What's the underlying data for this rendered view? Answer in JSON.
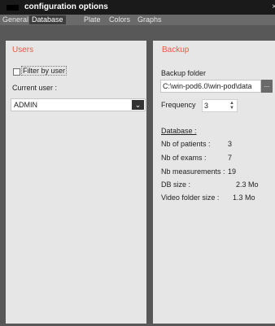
{
  "window": {
    "title": "configuration options",
    "close_glyph": "×"
  },
  "tabs": [
    {
      "label": "General"
    },
    {
      "label": "Database",
      "active": true
    },
    {
      "label": "Plate"
    },
    {
      "label": "Colors"
    },
    {
      "label": "Graphs"
    }
  ],
  "users": {
    "title": "Users",
    "filter_label": "Filter by user",
    "filter_checked": false,
    "current_user_label": "Current user :",
    "current_user_value": "ADMIN",
    "dropdown_glyph": "⌄"
  },
  "backup": {
    "title": "Backup",
    "folder_label": "Backup folder",
    "folder_value": "C:\\win-pod6.0\\win-pod\\data",
    "browse_label": "...",
    "frequency_label": "Frequency",
    "frequency_value": "3",
    "database_heading": "Database :",
    "stats": [
      {
        "label": "Nb of patients :",
        "value": "3"
      },
      {
        "label": "Nb of exams :",
        "value": "7"
      },
      {
        "label": "Nb measurements :",
        "value": "19"
      },
      {
        "label": "DB size :",
        "value": "2.3 Mo"
      },
      {
        "label": "Video folder size :",
        "value": "1.3 Mo"
      }
    ]
  },
  "colors": {
    "accent": "#e65c46",
    "titlebar": "#1a1a1a",
    "panel": "#e6e6e6",
    "background": "#585858"
  }
}
